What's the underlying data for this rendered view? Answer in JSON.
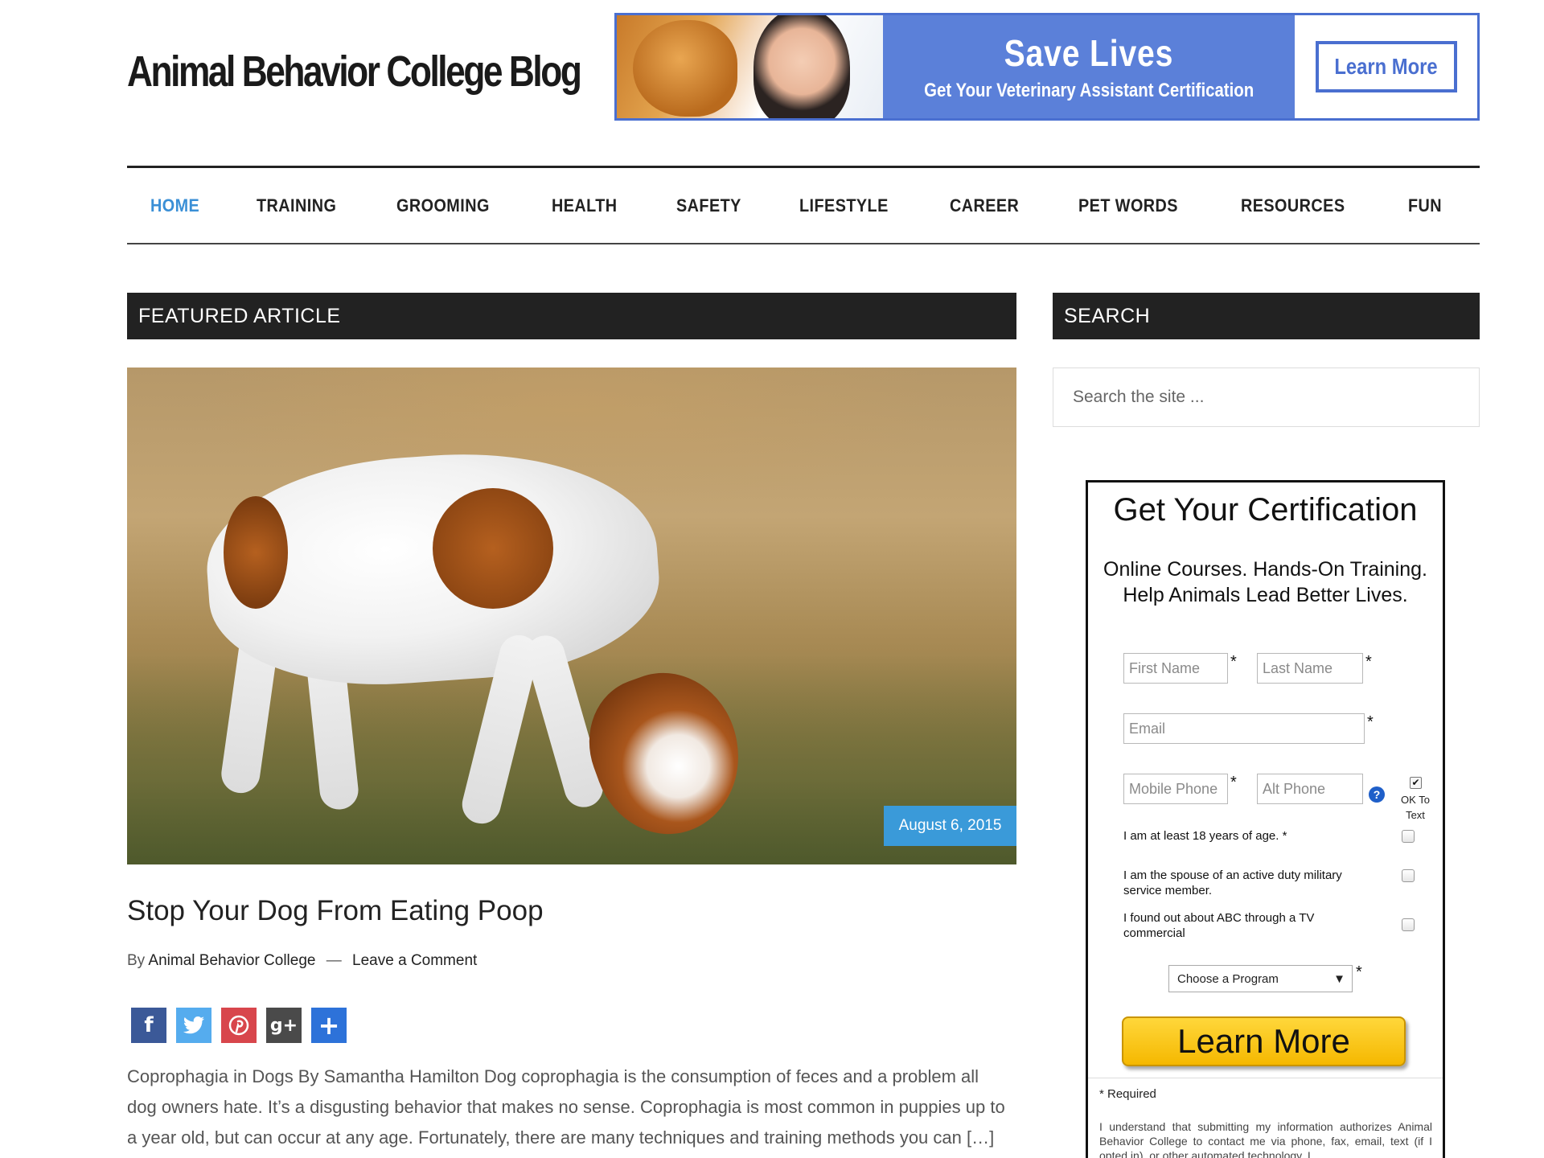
{
  "site": {
    "title": "Animal Behavior College Blog"
  },
  "ad": {
    "headline": "Save Lives",
    "subline": "Get Your Veterinary Assistant Certification",
    "cta": "Learn More",
    "color": "#5b80d9"
  },
  "nav": {
    "items": [
      "HOME",
      "TRAINING",
      "GROOMING",
      "HEALTH",
      "SAFETY",
      "LIFESTYLE",
      "CAREER",
      "PET WORDS",
      "RESOURCES",
      "FUN"
    ],
    "active": "HOME",
    "active_color": "#3a8fd6"
  },
  "featured": {
    "section_title": "FEATURED ARTICLE",
    "date": "August 6, 2015",
    "post_title": "Stop Your Dog From Eating Poop",
    "meta_by": "By",
    "author": "Animal Behavior College",
    "meta_sep": "—",
    "comment_link": "Leave a Comment",
    "share_icons": [
      "facebook-icon",
      "twitter-icon",
      "pinterest-icon",
      "google-plus-icon",
      "add-share-icon"
    ],
    "excerpt": "Coprophagia in Dogs By Samantha Hamilton Dog coprophagia is the consumption of feces and a problem all dog owners hate. It’s a disgusting behavior that makes no sense. Coprophagia is most common in puppies up to a year old, but can occur at any age. Fortunately, there are many techniques and training methods you can […]"
  },
  "sidebar": {
    "search_title": "SEARCH",
    "search_placeholder": "Search the site ..."
  },
  "cert_form": {
    "title": "Get Your Certification",
    "subtitle_line1": "Online Courses. Hands-On Training.",
    "subtitle_line2": "Help Animals Lead Better Lives.",
    "first_name_placeholder": "First Name",
    "last_name_placeholder": "Last Name",
    "email_placeholder": "Email",
    "mobile_placeholder": "Mobile Phone",
    "alt_phone_placeholder": "Alt Phone",
    "required_mark": "*",
    "help_icon": "?",
    "ok_to_text_checked": true,
    "ok_to_text_label": "OK To Text",
    "question_age": "I am at least 18 years of age. *",
    "question_military": "I am the spouse of an active duty military service member.",
    "question_tv": "I found out about ABC through a TV commercial",
    "program_select": "Choose a Program",
    "learn_more": "Learn More",
    "learn_more_color": "#f5b800",
    "required_note": "* Required",
    "disclaimer": "I understand that submitting my information authorizes Animal Behavior College to contact me via phone, fax, email, text (if I opted in), or other automated technology. I"
  }
}
